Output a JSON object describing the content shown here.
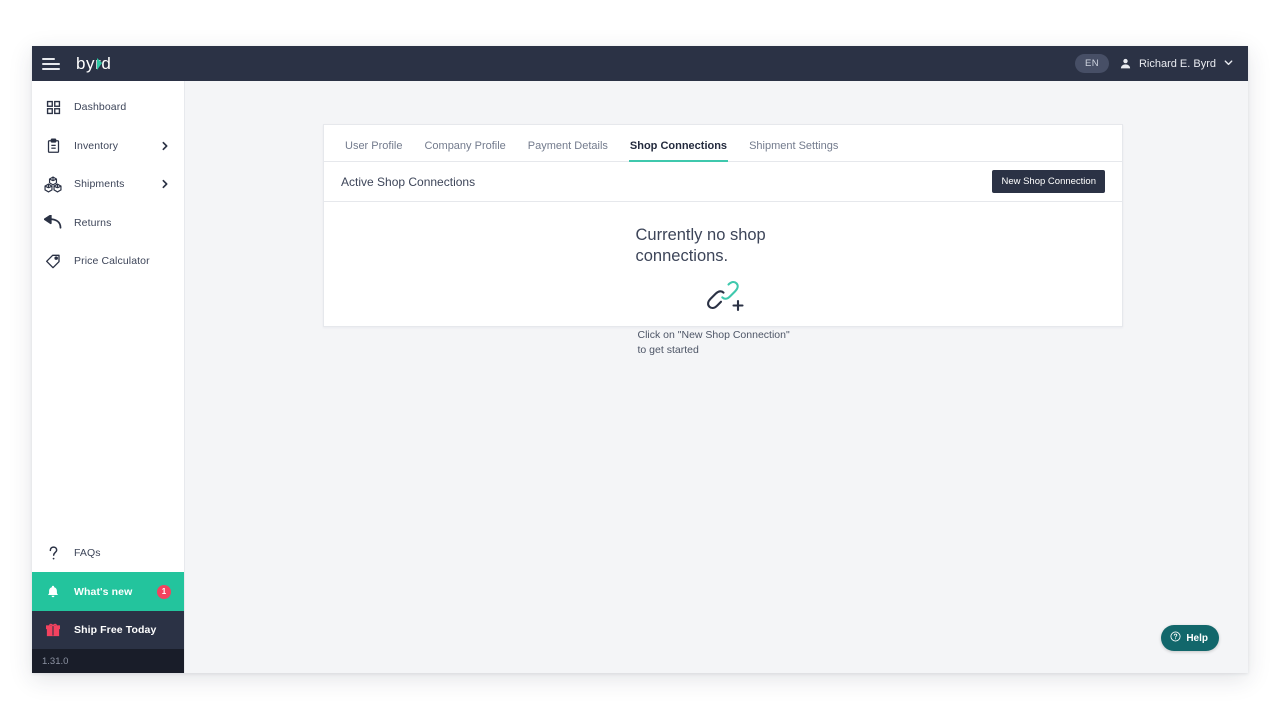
{
  "topbar": {
    "menu_icon": "hamburger-icon",
    "brand": "byrd",
    "language": "EN",
    "user_icon": "user-avatar-icon",
    "user_name": "Richard E. Byrd",
    "chevron_icon": "chevron-down-icon"
  },
  "sidebar": {
    "items": [
      {
        "label": "Dashboard",
        "icon": "dashboard-grid-icon",
        "has_chevron": false
      },
      {
        "label": "Inventory",
        "icon": "clipboard-icon",
        "has_chevron": true
      },
      {
        "label": "Shipments",
        "icon": "boxes-icon",
        "has_chevron": true
      },
      {
        "label": "Returns",
        "icon": "return-arrow-icon",
        "has_chevron": false
      },
      {
        "label": "Price Calculator",
        "icon": "price-tag-icon",
        "has_chevron": false
      }
    ],
    "faq": {
      "label": "FAQs",
      "icon": "question-mark-icon"
    },
    "whats_new": {
      "label": "What's new",
      "icon": "bell-icon",
      "badge": "1"
    },
    "ship_free": {
      "label": "Ship Free Today",
      "icon": "gift-icon"
    },
    "version": "1.31.0"
  },
  "tabs": [
    {
      "label": "User Profile",
      "active": false
    },
    {
      "label": "Company Profile",
      "active": false
    },
    {
      "label": "Payment Details",
      "active": false
    },
    {
      "label": "Shop Connections",
      "active": true
    },
    {
      "label": "Shipment Settings",
      "active": false
    }
  ],
  "card": {
    "title": "Active Shop Connections",
    "action_button": "New Shop Connection"
  },
  "empty_state": {
    "title": "Currently no shop connections.",
    "icon": "link-plus-icon",
    "subtitle_line1": "Click on \"New Shop Connection\"",
    "subtitle_line2": "to get started"
  },
  "help": {
    "label": "Help",
    "icon": "question-circle-icon"
  },
  "colors": {
    "brand_teal": "#23c49d",
    "dark_navy": "#2b3245",
    "accent_underline": "#3fc8ad",
    "badge_red": "#f3425f",
    "help_teal": "#12676b",
    "page_bg": "#f4f5f7"
  }
}
